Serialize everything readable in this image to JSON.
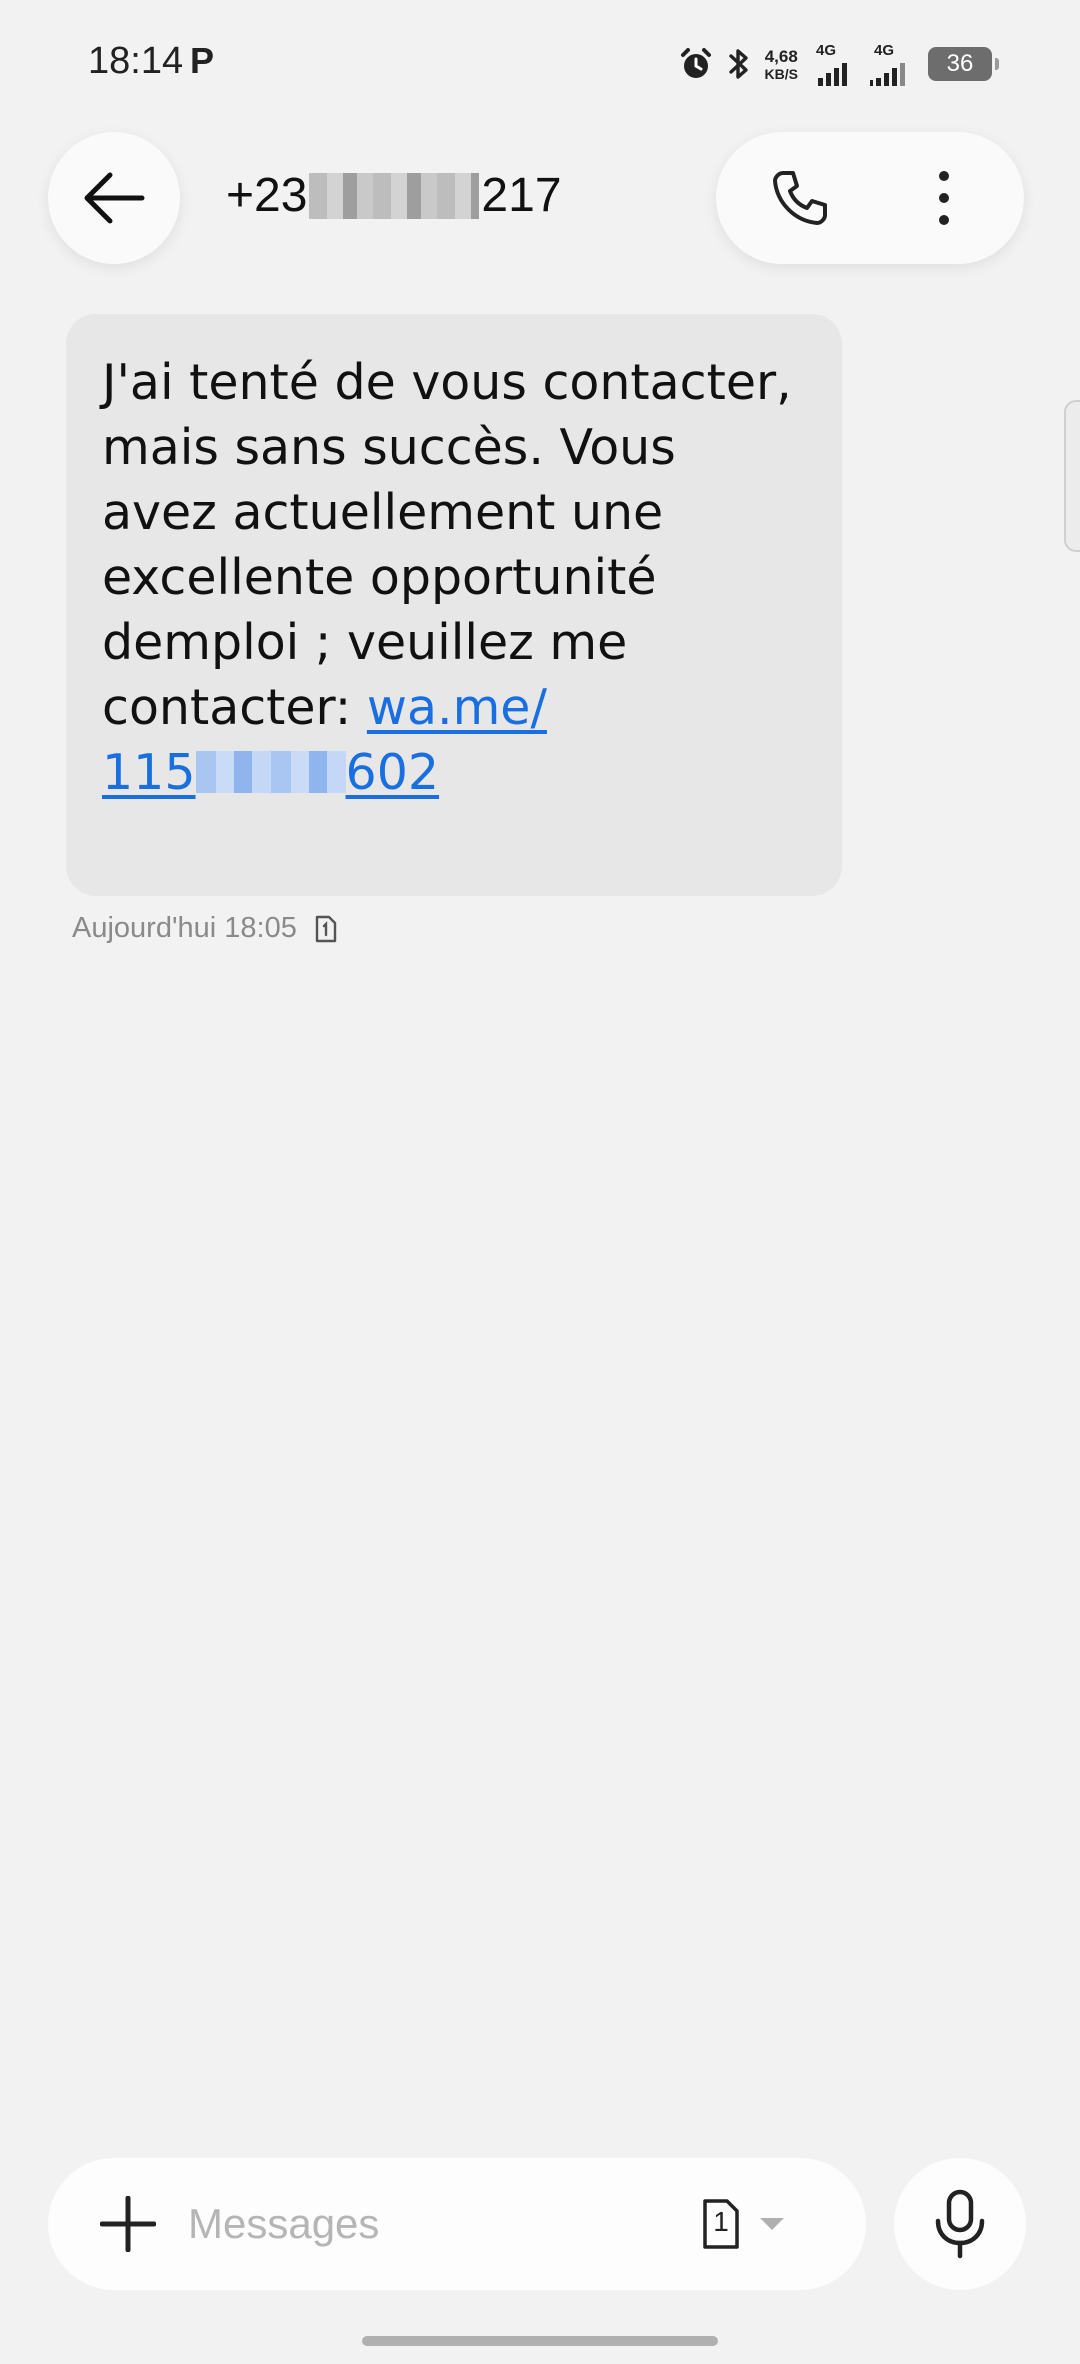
{
  "status_bar": {
    "time": "18:14",
    "notification_letter": "P",
    "net_speed_value": "4,68",
    "net_speed_unit": "KB/S",
    "sim1_label": "4G",
    "sim2_label": "4G",
    "battery": "36"
  },
  "header": {
    "contact_prefix": "+23",
    "contact_suffix": "217"
  },
  "message": {
    "text": "J'ai tenté de vous contacter, mais sans succès. Vous avez actuellement une excellente opportunité demploi ; veuillez me contacter: ",
    "link_start": "wa.me/",
    "link_mid": "115",
    "link_end": "602",
    "timestamp": "Aujourd'hui 18:05"
  },
  "composer": {
    "placeholder": "Messages",
    "sim_number": "1"
  },
  "icons": {
    "back": "arrow-left-icon",
    "call": "phone-icon",
    "more": "more-vertical-icon",
    "add": "plus-icon",
    "sim": "sim-card-icon",
    "mic": "microphone-icon"
  },
  "colors": {
    "background": "#f2f2f2",
    "bubble": "#e7e7e7",
    "link": "#1a6fe0"
  }
}
